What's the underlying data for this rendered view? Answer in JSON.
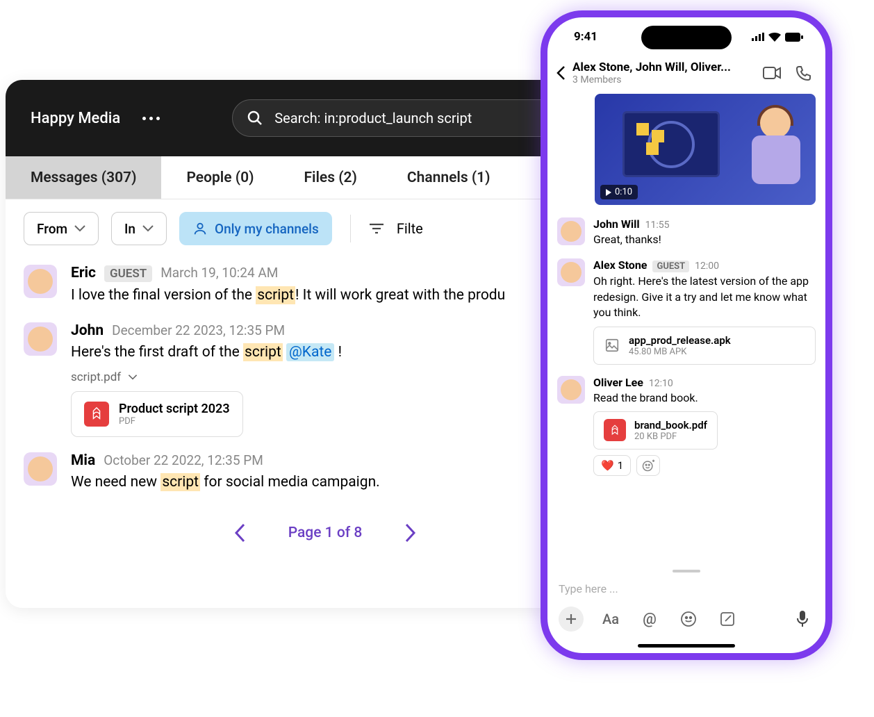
{
  "desktop": {
    "workspace": "Happy Media",
    "search_label": "Search: in:product_launch script",
    "tabs": [
      {
        "label": "Messages (307)"
      },
      {
        "label": "People (0)"
      },
      {
        "label": "Files (2)"
      },
      {
        "label": "Channels (1)"
      }
    ],
    "filters": {
      "from": "From",
      "in": "In",
      "only_my": "Only my channels",
      "filter_label": "Filte"
    },
    "messages": [
      {
        "name": "Eric",
        "guest": "GUEST",
        "date": "March 19, 10:24 AM",
        "text_pre": "I love the final version of the ",
        "text_hl": "script",
        "text_post": "! It will work great with the produ"
      },
      {
        "name": "John",
        "date": "December 22 2023, 12:35 PM",
        "text_pre": "Here's the first draft of the ",
        "text_hl": "script",
        "mention": "@Kate",
        "text_mention_post": " !",
        "file_label": "script.pdf",
        "file_card_name": "Product script 2023",
        "file_card_sub": "PDF"
      },
      {
        "name": "Mia",
        "date": "October 22 2022, 12:35 PM",
        "text_pre": "We need new ",
        "text_hl": "script",
        "text_post": " for social media campaign."
      }
    ],
    "pagination": "Page 1 of 8"
  },
  "phone": {
    "time": "9:41",
    "chat_title": "Alex Stone, John Will, Oliver...",
    "chat_sub": "3 Members",
    "video_duration": "0:10",
    "messages": [
      {
        "name": "John Will",
        "time": "11:55",
        "text": "Great, thanks!"
      },
      {
        "name": "Alex Stone",
        "guest": "GUEST",
        "time": "12:00",
        "text": "Oh right. Here's the latest version of the app redesign. Give it a try and let me know what you think.",
        "file_name": "app_prod_release.apk",
        "file_sub": "45.80 MB APK"
      },
      {
        "name": "Oliver Lee",
        "time": "12:10",
        "text": "Read the brand book.",
        "file_name": "brand_book.pdf",
        "file_sub": "20 KB PDF"
      }
    ],
    "reaction_emoji": "❤️",
    "reaction_count": "1",
    "input_placeholder": "Type here ...",
    "aa_label": "Aa",
    "at_label": "@"
  }
}
